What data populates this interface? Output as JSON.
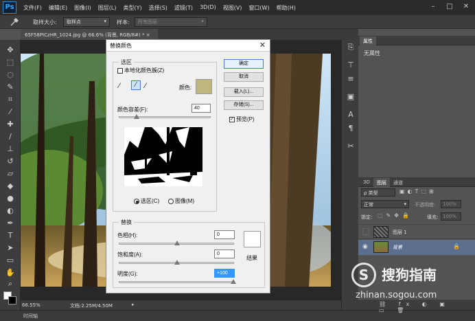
{
  "app": {
    "logo": "Ps"
  },
  "menu": [
    "文件(F)",
    "编辑(E)",
    "图像(I)",
    "图层(L)",
    "类型(Y)",
    "选择(S)",
    "滤镜(T)",
    "3D(D)",
    "视图(V)",
    "窗口(W)",
    "帮助(H)"
  ],
  "window_buttons": [
    "–",
    "□",
    "✕"
  ],
  "options": {
    "sample_size_label": "取样大小:",
    "sample_size_value": "取样点",
    "sample_label": "样本:",
    "sample_value": "所有图层"
  },
  "document": {
    "tab_title": "65F58PICzHR_1024.jpg @ 66.6% (背景, RGB/8#) *",
    "tab_close": "×"
  },
  "status": {
    "zoom": "66.55%",
    "doc_info": "文档:2.25M/4.50M"
  },
  "timeline": "时间轴",
  "properties": {
    "tab": "属性",
    "text": "无属性"
  },
  "layers_panel": {
    "tabs": [
      "3D",
      "图层",
      "通道"
    ],
    "filter_kind": "ρ 类型",
    "blend_mode": "正常",
    "opacity_label": "不透明度:",
    "opacity_value": "100%",
    "lock_label": "锁定:",
    "fill_label": "填充:",
    "fill_value": "100%",
    "layers": [
      {
        "name": "图层 1"
      },
      {
        "name": "背景"
      }
    ]
  },
  "dialog": {
    "title": "替换颜色",
    "close": "✕",
    "selection_group": "选区",
    "localized_clusters": "本地化颜色簇(Z)",
    "color_label": "颜色:",
    "swatch_color": "#bfb57d",
    "fuzziness_label": "颜色容差(F):",
    "fuzziness_value": "40",
    "radio_selection": "选区(C)",
    "radio_image": "图像(M)",
    "replacement_group": "替换",
    "hue_label": "色相(H):",
    "hue_value": "0",
    "saturation_label": "饱和度(A):",
    "saturation_value": "0",
    "lightness_label": "明度(G):",
    "lightness_value": "+100",
    "result_label": "结果",
    "result_color": "#ffffff",
    "buttons": {
      "ok": "确定",
      "cancel": "取消",
      "load": "载入(L)...",
      "save": "存储(S)..."
    },
    "preview_label": "预览(P)"
  },
  "watermark": {
    "cn": "搜狗指南",
    "url": "zhinan.sogou.com"
  }
}
